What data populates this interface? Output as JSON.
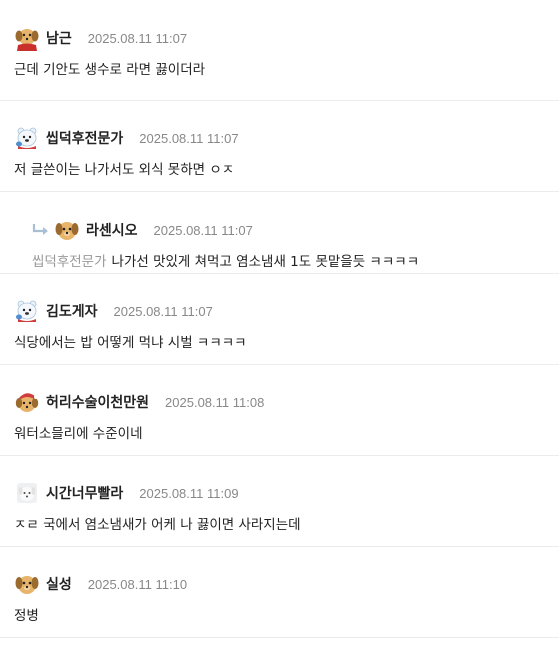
{
  "comments": [
    {
      "nick": "남근",
      "date": "2025.08.11 11:07",
      "text": "근데 기안도 생수로 라면 끓이더라",
      "avatar": "puppy-red-avatar-icon"
    },
    {
      "nick": "씹덕후전문가",
      "date": "2025.08.11 11:07",
      "text": "저 글쓴이는 나가서도 외식 못하면 ㅇㅈ",
      "avatar": "polar-bear-avatar-icon"
    },
    {
      "nick": "라센시오",
      "date": "2025.08.11 11:07",
      "mention": "씹덕후전문가",
      "text": "나가선 맛있게 쳐먹고 염소냄새 1도 못맡을듯 ㅋㅋㅋㅋ",
      "avatar": "puppy-avatar-icon"
    },
    {
      "nick": "김도게자",
      "date": "2025.08.11 11:07",
      "text": "식당에서는 밥 어떻게 먹냐 시벌 ㅋㅋㅋㅋ",
      "avatar": "polar-bear-avatar-icon"
    },
    {
      "nick": "허리수술이천만원",
      "date": "2025.08.11 11:08",
      "text": "워터소믈리에 수준이네",
      "avatar": "puppy-santa-avatar-icon"
    },
    {
      "nick": "시간너무빨라",
      "date": "2025.08.11 11:09",
      "text": "ㅈㄹ 국에서 염소냄새가 어케 나 끓이면 사라지는데",
      "avatar": "white-dog-avatar-icon"
    },
    {
      "nick": "실성",
      "date": "2025.08.11 11:10",
      "text": "정병",
      "avatar": "puppy-avatar-icon"
    }
  ],
  "colors": {
    "nick": "#222222",
    "date": "#888888",
    "mention": "#999999",
    "divider": "#ececec"
  }
}
